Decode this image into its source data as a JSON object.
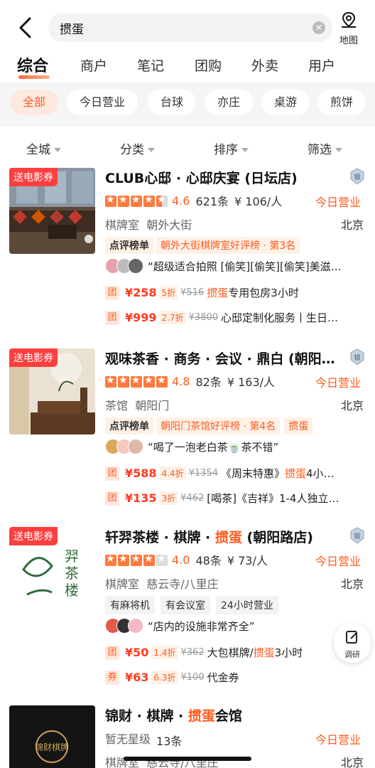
{
  "search": {
    "query": "掼蛋",
    "map_label": "地图"
  },
  "tabs": [
    {
      "label": "综合",
      "active": true
    },
    {
      "label": "商户"
    },
    {
      "label": "笔记"
    },
    {
      "label": "团购"
    },
    {
      "label": "外卖"
    },
    {
      "label": "用户"
    }
  ],
  "chips": [
    {
      "label": "全部",
      "active": true
    },
    {
      "label": "今日营业"
    },
    {
      "label": "台球"
    },
    {
      "label": "亦庄"
    },
    {
      "label": "桌游"
    },
    {
      "label": "煎饼"
    }
  ],
  "sort": [
    {
      "label": "全城"
    },
    {
      "label": "分类"
    },
    {
      "label": "排序"
    },
    {
      "label": "筛选"
    }
  ],
  "accent_color": "#ff5a1f",
  "shops": [
    {
      "badge": "送电影券",
      "title": "CLUB心邸 · 心邸庆宴 (日坛店)",
      "rating": 4.6,
      "rating_text": "4.6",
      "reviews": "621条",
      "price": "¥ 106/人",
      "status": "今日营业",
      "category": "棋牌室",
      "area": "朝外大街",
      "city": "北京",
      "rank_prefix": "点评",
      "rank_mid": "榜单",
      "rank_text": "朝外大街棋牌室好评榜 · 第3名",
      "quote": "“超级适合拍照 [偷笑][偷笑][偷笑]美滋…",
      "deals": [
        {
          "type": "团",
          "price": "¥258",
          "discount": "5折",
          "original": "¥516",
          "name_hl": "掼蛋",
          "name": "专用包房3小时"
        },
        {
          "type": "团",
          "price": "¥999",
          "discount": "2.7折",
          "original": "¥3800",
          "name_hl": "",
          "name": "心邸定制化服务丨生日…"
        }
      ]
    },
    {
      "badge": "送电影券",
      "title": "观味茶香 · 商务 · 会议 · 鼎白 (朝阳…",
      "rating": 4.8,
      "rating_text": "4.8",
      "reviews": "82条",
      "price": "¥ 163/人",
      "status": "今日营业",
      "category": "茶馆",
      "area": "朝阳门",
      "city": "北京",
      "rank_prefix": "点评",
      "rank_mid": "榜单",
      "rank_text": "朝阳门茶馆好评榜 · 第4名",
      "tag": "掼蛋",
      "quote": "“喝了一泡老白茶🍵茶不错”",
      "deals": [
        {
          "type": "团",
          "price": "¥588",
          "discount": "4.4折",
          "original": "¥1354",
          "name_pre": "《周末特惠》",
          "name_hl": "掼蛋",
          "name": "4小…"
        },
        {
          "type": "团",
          "price": "¥135",
          "discount": "3折",
          "original": "¥462",
          "name_pre": "",
          "name_hl": "",
          "name": "[喝茶]《吉祥》1-4人独立…"
        }
      ]
    },
    {
      "badge": "送电影券",
      "title_pre": "轩羿茶楼 · 棋牌 · ",
      "title_hl": "掼蛋",
      "title_post": " (朝阳路店)",
      "rating": 4.0,
      "rating_text": "4.0",
      "reviews": "48条",
      "price": "¥ 73/人",
      "status": "今日营业",
      "category": "棋牌室",
      "area": "慈云寺/八里庄",
      "city": "北京",
      "features": [
        "有麻将机",
        "有会议室",
        "24小时营业"
      ],
      "quote": "“店内的设施非常齐全”",
      "deals": [
        {
          "type": "团",
          "price": "¥50",
          "discount": "1.4折",
          "original": "¥362",
          "name_pre": "大包棋牌/",
          "name_hl": "掼蛋",
          "name": "3小时"
        },
        {
          "type": "券",
          "price": "¥63",
          "discount": "6.3折",
          "original": "¥100",
          "name_pre": "",
          "name_hl": "",
          "name": "代金券"
        }
      ]
    },
    {
      "title_pre": "锦财 · 棋牌 · ",
      "title_hl": "掼蛋",
      "title_post": "会馆",
      "rating_text": "暂无星级",
      "reviews": "13条",
      "status": "今日营业",
      "category": "棋牌室",
      "area": "慈云寺/八里庄",
      "city": "北京",
      "logo_text": "锦财棋牌"
    }
  ],
  "fab": {
    "label": "调研"
  }
}
